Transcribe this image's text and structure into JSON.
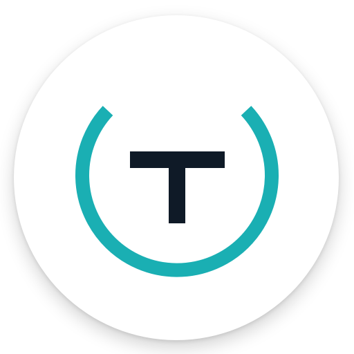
{
  "app_icon": {
    "logo_letter": "T",
    "colors": {
      "background": "#ffffff",
      "ring": "#1aafb3",
      "letter": "#0f1a27"
    },
    "icon": "app-logo-icon"
  }
}
